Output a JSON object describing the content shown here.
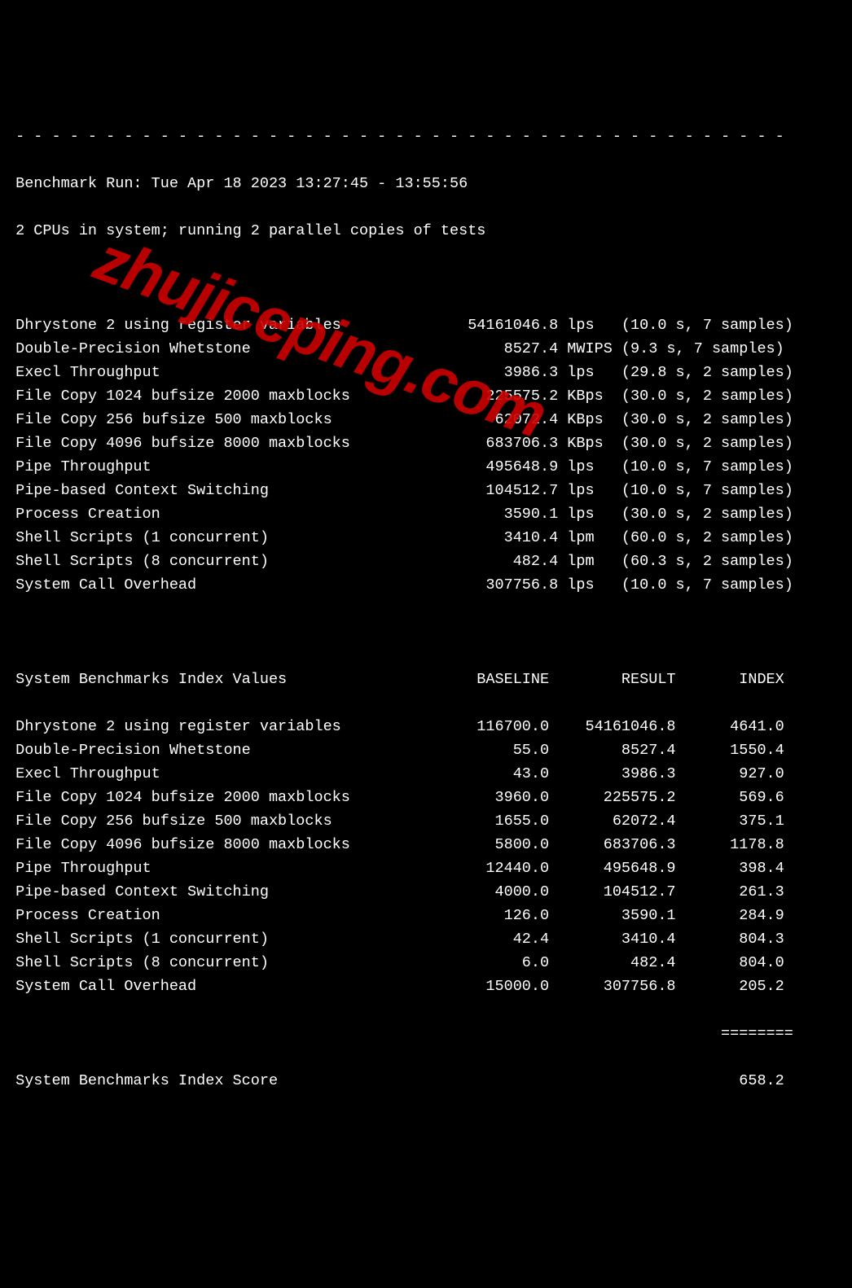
{
  "watermark_text": "zhujiceping.com",
  "separator_top": " - - - - - - - - - - - - - - - - - - - - - - - - - - - - - - - - - - - - - - - - - - -",
  "run_info": " Benchmark Run: Tue Apr 18 2023 13:27:45 - 13:55:56",
  "cpu_info": " 2 CPUs in system; running 2 parallel copies of tests",
  "tests": [
    {
      "name": "Dhrystone 2 using register variables",
      "value": "54161046.8",
      "unit": "lps",
      "timing": "(10.0 s, 7 samples)"
    },
    {
      "name": "Double-Precision Whetstone",
      "value": "8527.4",
      "unit": "MWIPS",
      "timing": "(9.3 s, 7 samples)"
    },
    {
      "name": "Execl Throughput",
      "value": "3986.3",
      "unit": "lps",
      "timing": "(29.8 s, 2 samples)"
    },
    {
      "name": "File Copy 1024 bufsize 2000 maxblocks",
      "value": "225575.2",
      "unit": "KBps",
      "timing": "(30.0 s, 2 samples)"
    },
    {
      "name": "File Copy 256 bufsize 500 maxblocks",
      "value": "62072.4",
      "unit": "KBps",
      "timing": "(30.0 s, 2 samples)"
    },
    {
      "name": "File Copy 4096 bufsize 8000 maxblocks",
      "value": "683706.3",
      "unit": "KBps",
      "timing": "(30.0 s, 2 samples)"
    },
    {
      "name": "Pipe Throughput",
      "value": "495648.9",
      "unit": "lps",
      "timing": "(10.0 s, 7 samples)"
    },
    {
      "name": "Pipe-based Context Switching",
      "value": "104512.7",
      "unit": "lps",
      "timing": "(10.0 s, 7 samples)"
    },
    {
      "name": "Process Creation",
      "value": "3590.1",
      "unit": "lps",
      "timing": "(30.0 s, 2 samples)"
    },
    {
      "name": "Shell Scripts (1 concurrent)",
      "value": "3410.4",
      "unit": "lpm",
      "timing": "(60.0 s, 2 samples)"
    },
    {
      "name": "Shell Scripts (8 concurrent)",
      "value": "482.4",
      "unit": "lpm",
      "timing": "(60.3 s, 2 samples)"
    },
    {
      "name": "System Call Overhead",
      "value": "307756.8",
      "unit": "lps",
      "timing": "(10.0 s, 7 samples)"
    }
  ],
  "index_header_label": "System Benchmarks Index Values",
  "index_col_baseline": "BASELINE",
  "index_col_result": "RESULT",
  "index_col_index": "INDEX",
  "index_rows": [
    {
      "name": "Dhrystone 2 using register variables",
      "baseline": "116700.0",
      "result": "54161046.8",
      "index": "4641.0"
    },
    {
      "name": "Double-Precision Whetstone",
      "baseline": "55.0",
      "result": "8527.4",
      "index": "1550.4"
    },
    {
      "name": "Execl Throughput",
      "baseline": "43.0",
      "result": "3986.3",
      "index": "927.0"
    },
    {
      "name": "File Copy 1024 bufsize 2000 maxblocks",
      "baseline": "3960.0",
      "result": "225575.2",
      "index": "569.6"
    },
    {
      "name": "File Copy 256 bufsize 500 maxblocks",
      "baseline": "1655.0",
      "result": "62072.4",
      "index": "375.1"
    },
    {
      "name": "File Copy 4096 bufsize 8000 maxblocks",
      "baseline": "5800.0",
      "result": "683706.3",
      "index": "1178.8"
    },
    {
      "name": "Pipe Throughput",
      "baseline": "12440.0",
      "result": "495648.9",
      "index": "398.4"
    },
    {
      "name": "Pipe-based Context Switching",
      "baseline": "4000.0",
      "result": "104512.7",
      "index": "261.3"
    },
    {
      "name": "Process Creation",
      "baseline": "126.0",
      "result": "3590.1",
      "index": "284.9"
    },
    {
      "name": "Shell Scripts (1 concurrent)",
      "baseline": "42.4",
      "result": "3410.4",
      "index": "804.3"
    },
    {
      "name": "Shell Scripts (8 concurrent)",
      "baseline": "6.0",
      "result": "482.4",
      "index": "804.0"
    },
    {
      "name": "System Call Overhead",
      "baseline": "15000.0",
      "result": "307756.8",
      "index": "205.2"
    }
  ],
  "divider_bottom": "                                                                               ========",
  "score_label": "System Benchmarks Index Score",
  "score_value": "658.2"
}
